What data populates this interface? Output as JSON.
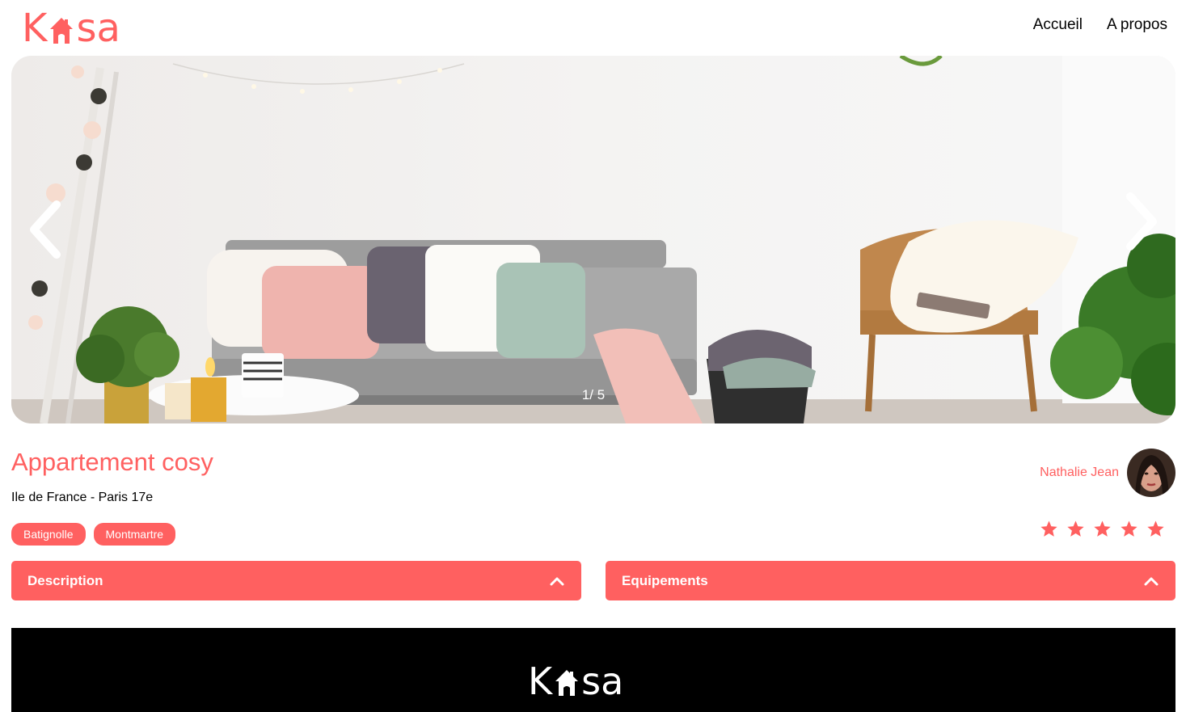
{
  "brand": {
    "letters": [
      "K",
      "sa"
    ],
    "color": "#FF6060"
  },
  "nav": {
    "home": "Accueil",
    "about": "A propos"
  },
  "carousel": {
    "counter": "1/ 5",
    "prev_icon": "chevron-left-icon",
    "next_icon": "chevron-right-icon"
  },
  "listing": {
    "title": "Appartement cosy",
    "location": "Ile de France - Paris 17e",
    "tags": [
      "Batignolle",
      "Montmartre"
    ],
    "rating": 5,
    "rating_max": 5
  },
  "host": {
    "name": "Nathalie Jean"
  },
  "collapses": {
    "description": "Description",
    "equipments": "Equipements"
  },
  "colors": {
    "accent": "#FF6060",
    "footer_bg": "#000000"
  }
}
